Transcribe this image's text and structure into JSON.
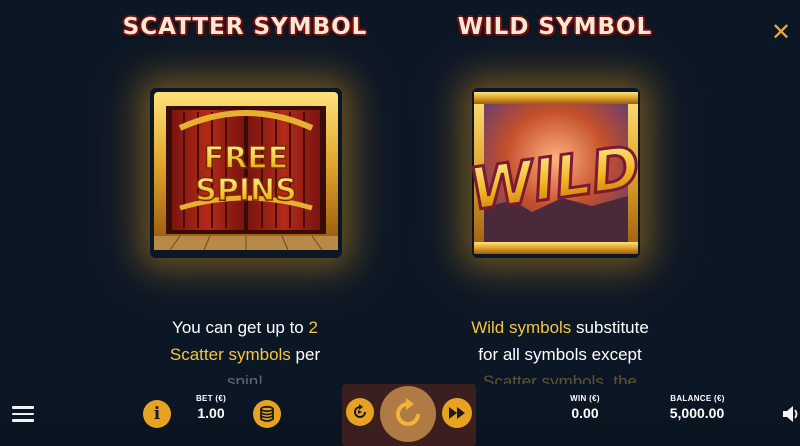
{
  "header": {
    "scatter_title": "SCATTER SYMBOL",
    "wild_title": "WILD SYMBOL",
    "close_icon": "close-icon",
    "close_glyph": "✕"
  },
  "symbols": {
    "scatter_text_line1": "FREE",
    "scatter_text_line2": "SPINS",
    "wild_text": "WILD"
  },
  "descriptions": {
    "scatter": {
      "part1": "You can get up to ",
      "highlight1": "2",
      "highlight2": "Scatter symbols",
      "part2": " per",
      "part3": "spin!"
    },
    "wild": {
      "highlight1": "Wild symbols",
      "part1": " substitute",
      "part2": "for all symbols except",
      "part3": "Scatter symbols, the"
    }
  },
  "bottom_bar": {
    "bet_label": "BET (€)",
    "bet_value": "1.00",
    "win_label": "WIN (€)",
    "win_value": "0.00",
    "balance_label": "BALANCE (€)",
    "balance_value": "5,000.00",
    "info_glyph": "i"
  },
  "colors": {
    "background": "#0c1726",
    "accent_gold": "#e8a222",
    "highlight_text": "#f4c542",
    "title_outline": "#7a1010"
  }
}
